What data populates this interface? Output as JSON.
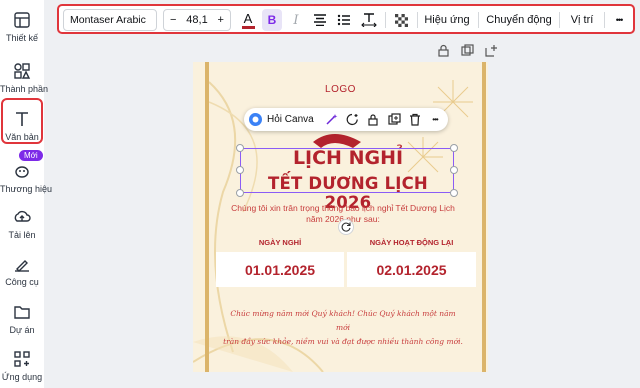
{
  "sidebar": {
    "items": [
      {
        "label": "Thiết kế",
        "icon": "design-icon"
      },
      {
        "label": "Thành phần",
        "icon": "elements-icon"
      },
      {
        "label": "Văn bản",
        "icon": "text-icon"
      },
      {
        "label": "Thương hiệu",
        "icon": "brand-icon",
        "badge": "Mới"
      },
      {
        "label": "Tải lên",
        "icon": "upload-icon"
      },
      {
        "label": "Công cụ",
        "icon": "tools-icon"
      },
      {
        "label": "Dự án",
        "icon": "folder-icon"
      },
      {
        "label": "Ứng dụng",
        "icon": "apps-icon"
      }
    ],
    "active": "Văn bản"
  },
  "toolbar": {
    "font_family": "Montaser Arabic",
    "font_size": "48,1",
    "decrease": "−",
    "increase": "+",
    "text_color_glyph": "A",
    "bold_glyph": "B",
    "italic_glyph": "I",
    "effects_label": "Hiệu ứng",
    "animate_label": "Chuyển động",
    "position_label": "Vị trí",
    "more_glyph": "•••"
  },
  "context_menu": {
    "canva_label": "Hỏi Canva",
    "more_glyph": "•••"
  },
  "design": {
    "logo": "LOGO",
    "title_line1": "LỊCH NGHỈ",
    "title_line2": "TẾT DƯƠNG LỊCH 2026",
    "subtitle_line1": "Chúng tôi xin trân trọng thông báo lịch nghỉ Tết Dương Lịch",
    "subtitle_line2": "năm 2026 như sau:",
    "left_heading": "NGÀY NGHỈ",
    "left_date": "01.01.2025",
    "right_heading": "NGÀY HOẠT ĐỘNG LẠI",
    "right_date": "02.01.2025",
    "wish_line1": "Chúc mừng năm mới Quý khách! Chúc Quý khách một năm mới",
    "wish_line2": "tràn đầy sức khỏe, niềm vui và đạt được nhiều thành công mới."
  },
  "colors": {
    "accent_purple": "#7d2ae8",
    "highlight_red": "#e0353b",
    "design_red": "#b3232d",
    "gold": "#dbb46a"
  }
}
